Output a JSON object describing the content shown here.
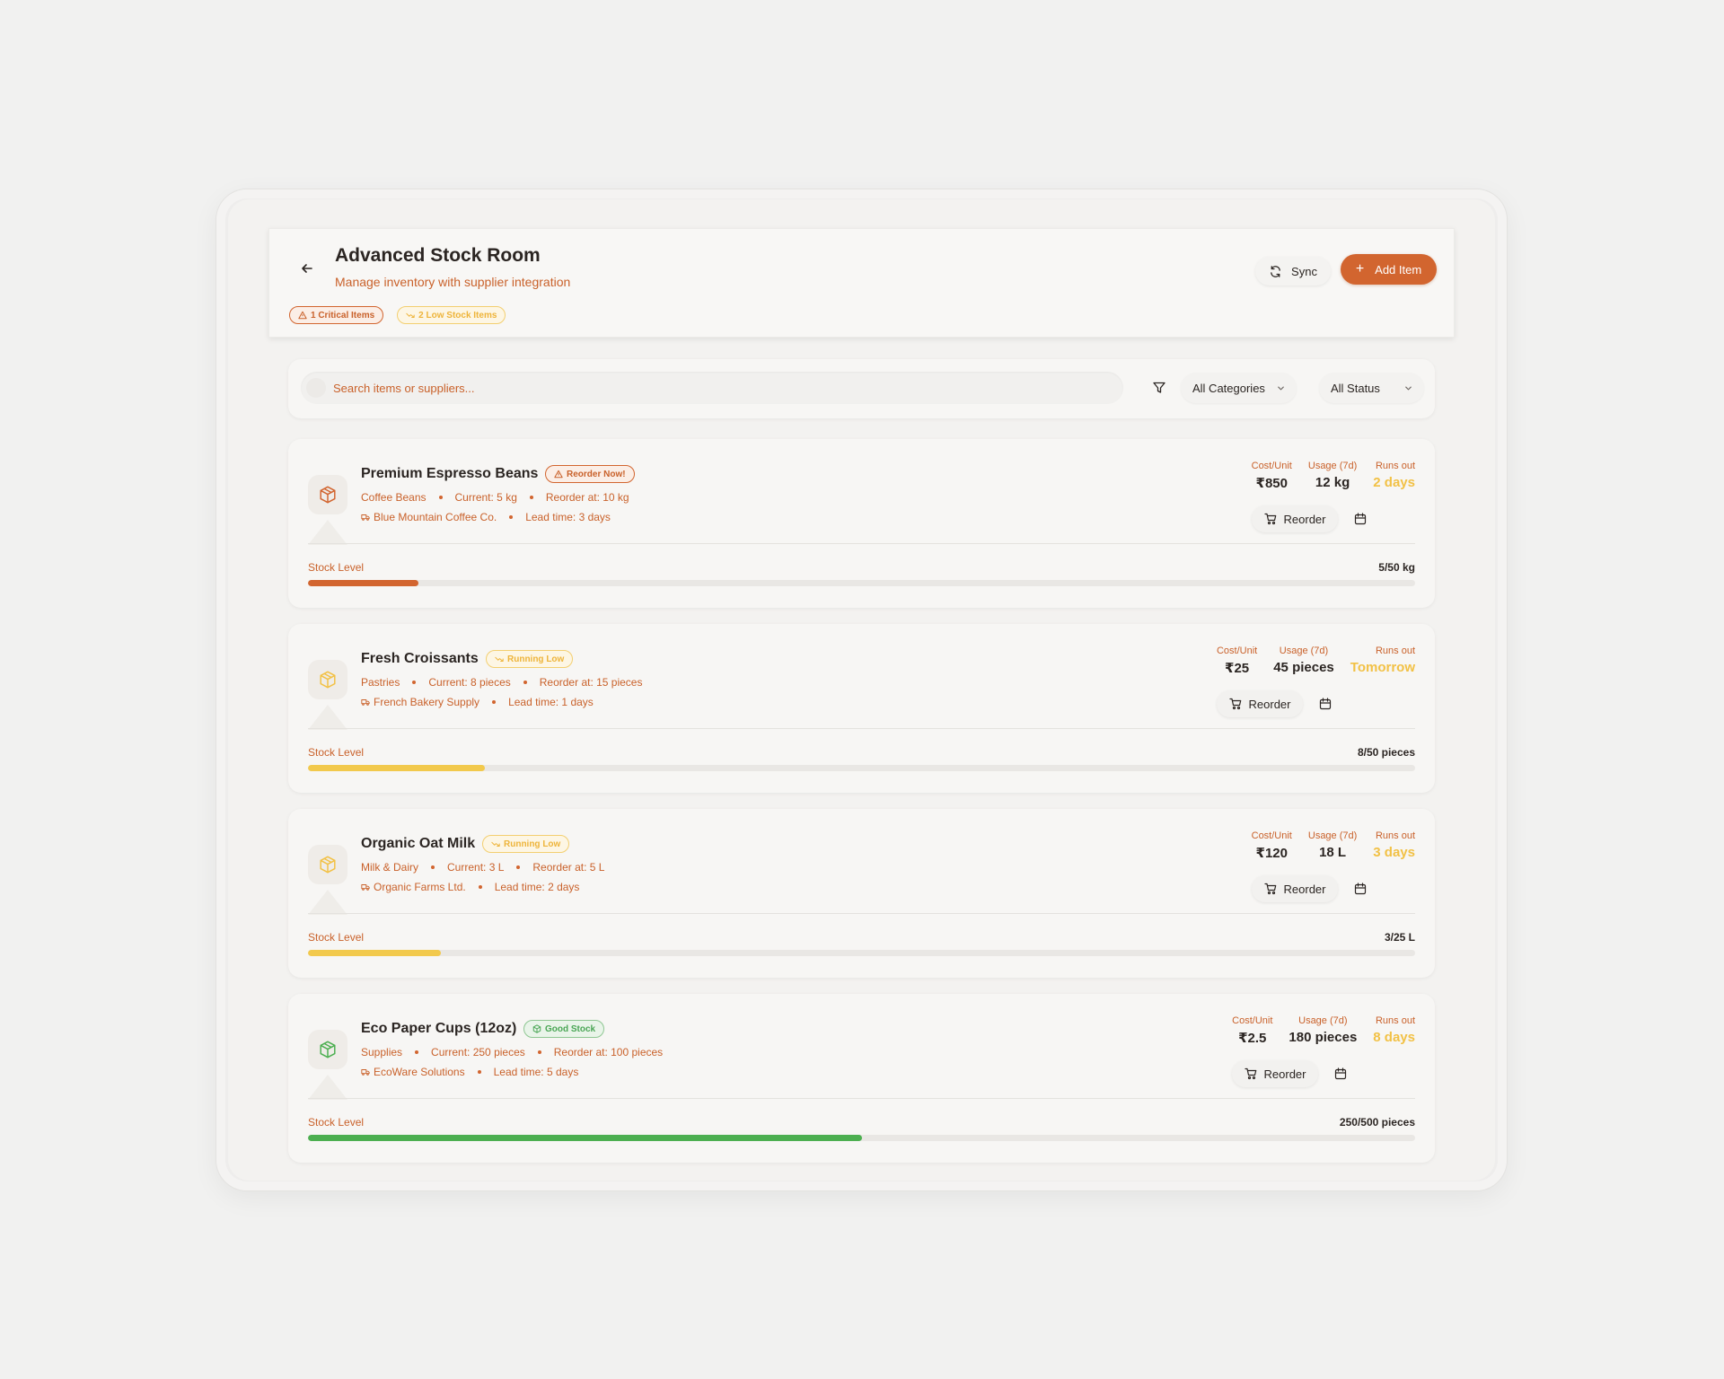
{
  "header": {
    "title": "Advanced Stock Room",
    "subtitle": "Manage inventory with supplier integration",
    "badges": {
      "critical": "1 Critical Items",
      "low": "2 Low Stock Items"
    },
    "sync_label": "Sync",
    "add_label": "Add Item"
  },
  "filters": {
    "search_placeholder": "Search items or suppliers...",
    "category": "All Categories",
    "status": "All Status"
  },
  "stats_labels": {
    "cost": "Cost/Unit",
    "usage": "Usage (7d)",
    "runs": "Runs out"
  },
  "stock_label": "Stock Level",
  "reorder_label": "Reorder",
  "colors": {
    "accent": "#d2652f",
    "warning": "#f2c145",
    "good": "#4caf50",
    "runs_out": "#f2c145"
  },
  "items": [
    {
      "name": "Premium Espresso Beans",
      "status": "Reorder Now!",
      "category": "Coffee Beans",
      "current": "Current: 5 kg",
      "reorder_at": "Reorder at: 10 kg",
      "supplier": "Blue Mountain Coffee Co.",
      "lead_time": "Lead time: 3 days",
      "cost": "₹850",
      "usage": "12 kg",
      "runs_out": "2 days",
      "stock_text": "5/50 kg",
      "stock_fraction": 0.1
    },
    {
      "name": "Fresh Croissants",
      "status": "Running Low",
      "category": "Pastries",
      "current": "Current: 8 pieces",
      "reorder_at": "Reorder at: 15 pieces",
      "supplier": "French Bakery Supply",
      "lead_time": "Lead time: 1 days",
      "cost": "₹25",
      "usage": "45 pieces",
      "runs_out": "Tomorrow",
      "stock_text": "8/50 pieces",
      "stock_fraction": 0.16
    },
    {
      "name": "Organic Oat Milk",
      "status": "Running Low",
      "category": "Milk & Dairy",
      "current": "Current: 3 L",
      "reorder_at": "Reorder at: 5 L",
      "supplier": "Organic Farms Ltd.",
      "lead_time": "Lead time: 2 days",
      "cost": "₹120",
      "usage": "18 L",
      "runs_out": "3 days",
      "stock_text": "3/25 L",
      "stock_fraction": 0.12
    },
    {
      "name": "Eco Paper Cups (12oz)",
      "status": "Good Stock",
      "category": "Supplies",
      "current": "Current: 250 pieces",
      "reorder_at": "Reorder at: 100 pieces",
      "supplier": "EcoWare Solutions",
      "lead_time": "Lead time: 5 days",
      "cost": "₹2.5",
      "usage": "180 pieces",
      "runs_out": "8 days",
      "stock_text": "250/500 pieces",
      "stock_fraction": 0.5
    }
  ]
}
